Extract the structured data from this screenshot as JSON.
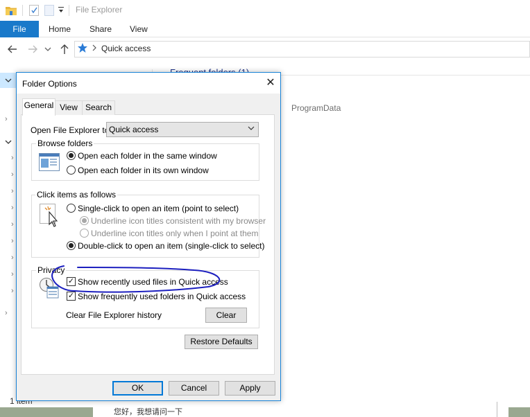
{
  "explorer": {
    "window_title": "File Explorer",
    "ribbon_tabs": [
      "File",
      "Home",
      "Share",
      "View"
    ],
    "address": {
      "location": "Quick access"
    },
    "nav_tree_chevrons": [
      "›",
      "›",
      "›",
      "›",
      "›",
      "›",
      "›",
      "›",
      "›",
      "›",
      "›",
      "›",
      "›"
    ],
    "content_header": "Frequent folders (1)",
    "content_item": "ProgramData",
    "status": "1 item",
    "taskbar_text": "您好，我想请问一下"
  },
  "dialog": {
    "title": "Folder Options",
    "close_glyph": "✕",
    "tabs": [
      "General",
      "View",
      "Search"
    ],
    "active_tab": "General",
    "open_explorer_label": "Open File Explorer to:",
    "open_explorer_value": "Quick access",
    "browse_folders": {
      "title": "Browse folders",
      "options": [
        "Open each folder in the same window",
        "Open each folder in its own window"
      ],
      "selected": 0
    },
    "click_items": {
      "title": "Click items as follows",
      "single_click": "Single-click to open an item (point to select)",
      "underline_browser": "Underline icon titles consistent with my browser",
      "underline_point": "Underline icon titles only when I point at them",
      "double_click": "Double-click to open an item (single-click to select)",
      "selected": "double_click"
    },
    "privacy": {
      "title": "Privacy",
      "show_recent_files": "Show recently used files in Quick access",
      "show_recent_files_checked": true,
      "show_frequent_folders": "Show frequently used folders in Quick access",
      "show_frequent_folders_checked": true,
      "clear_history_label": "Clear File Explorer history",
      "clear_button": "Clear"
    },
    "restore_defaults": "Restore Defaults",
    "buttons": {
      "ok": "OK",
      "cancel": "Cancel",
      "apply": "Apply"
    }
  },
  "colors": {
    "accent": "#1979ca",
    "dialog_border": "#1883d7",
    "annotation_ink": "#1c1fbf"
  },
  "glyphs": {
    "check": "✓",
    "dropdown": "⌄"
  }
}
